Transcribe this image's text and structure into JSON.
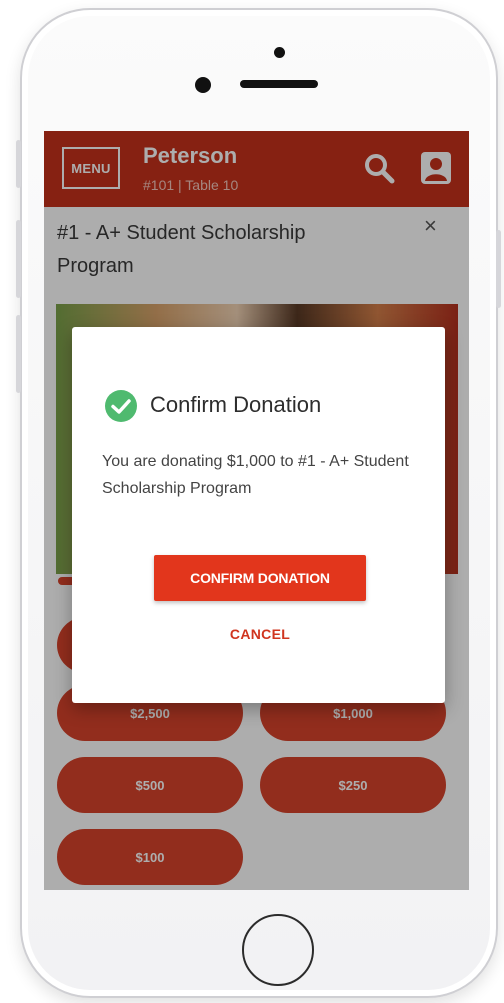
{
  "header": {
    "menu_label": "MENU",
    "user_name": "Peterson",
    "user_subtitle": "#101 | Table 10",
    "icons": [
      "search-icon",
      "account-icon"
    ]
  },
  "item": {
    "title": "#1 - A+ Student Scholarship Program",
    "close_symbol": "×"
  },
  "amounts": [
    "$2,500",
    "$1,000",
    "$500",
    "$250",
    "$100"
  ],
  "modal": {
    "title": "Confirm Donation",
    "body": "You are donating $1,000 to #1 - A+ Student Scholarship Program",
    "confirm_label": "CONFIRM DONATION",
    "cancel_label": "CANCEL",
    "icon": "check-circle-icon"
  },
  "colors": {
    "brand": "#c6321b",
    "button": "#d7432b",
    "confirm": "#e2361c",
    "success": "#4fba6f"
  }
}
